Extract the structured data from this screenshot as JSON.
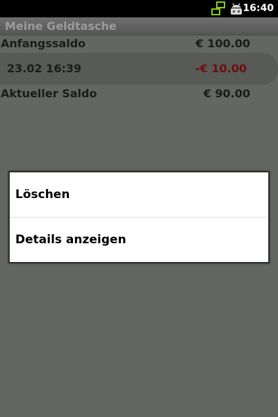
{
  "status_bar": {
    "time": "16:40",
    "icons": [
      "network-sync-icon",
      "usb-debug-icon"
    ]
  },
  "app": {
    "title": "Meine Geldtasche"
  },
  "summary": {
    "opening_balance_label": "Anfangssaldo",
    "opening_balance_value": "€ 100.00",
    "current_balance_label": "Aktueller Saldo",
    "current_balance_value": "€ 90.00"
  },
  "transactions": [
    {
      "date": "23.02 16:39",
      "amount": "-€ 10.00",
      "amount_color": "#6e0f0f"
    }
  ],
  "context_menu": {
    "items": [
      {
        "label": "Löschen"
      },
      {
        "label": "Details anzeigen"
      }
    ]
  },
  "colors": {
    "dim_background": "#646663",
    "status_bar": "#000000",
    "dialog_background": "#ffffff",
    "network_icon": "#7ed321"
  }
}
